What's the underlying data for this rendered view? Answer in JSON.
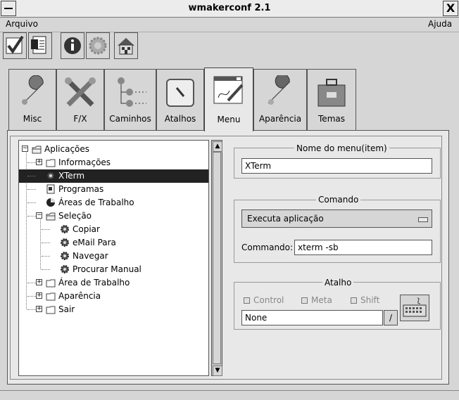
{
  "window": {
    "title": "wmakerconf 2.1",
    "close_glyph": "X"
  },
  "menubar": {
    "left": "Arquivo",
    "right": "Ajuda"
  },
  "toolbar": [
    {
      "icon": "checkmark-icon"
    },
    {
      "icon": "document-icon"
    },
    {
      "icon": "info-icon"
    },
    {
      "icon": "gear-icon"
    },
    {
      "icon": "house-icon"
    }
  ],
  "tabs": [
    {
      "label": "Misc"
    },
    {
      "label": "F/X"
    },
    {
      "label": "Caminhos"
    },
    {
      "label": "Atalhos"
    },
    {
      "label": "Menu",
      "active": true
    },
    {
      "label": "Aparência"
    },
    {
      "label": "Temas"
    }
  ],
  "tree": [
    {
      "label": "Aplicações",
      "level": 0,
      "icon": "folder-open",
      "expander": "−"
    },
    {
      "label": "Informações",
      "level": 1,
      "icon": "folder",
      "expander": "+"
    },
    {
      "label": "XTerm",
      "level": 1,
      "icon": "gear",
      "selected": true
    },
    {
      "label": "Programas",
      "level": 1,
      "icon": "doc"
    },
    {
      "label": "Áreas de Trabalho",
      "level": 1,
      "icon": "pie"
    },
    {
      "label": "Seleção",
      "level": 1,
      "icon": "folder-open",
      "expander": "−"
    },
    {
      "label": "Copiar",
      "level": 2,
      "icon": "gear"
    },
    {
      "label": "eMail Para",
      "level": 2,
      "icon": "gear"
    },
    {
      "label": "Navegar",
      "level": 2,
      "icon": "gear"
    },
    {
      "label": "Procurar Manual",
      "level": 2,
      "icon": "gear"
    },
    {
      "label": "Área de Trabalho",
      "level": 1,
      "icon": "folder",
      "expander": "+"
    },
    {
      "label": "Aparência",
      "level": 1,
      "icon": "folder",
      "expander": "+"
    },
    {
      "label": "Sair",
      "level": 1,
      "icon": "folder",
      "expander": "+"
    }
  ],
  "menu_item": {
    "title": "Nome do menu(item)",
    "value": "XTerm"
  },
  "command": {
    "title": "Comando",
    "action": "Executa aplicação",
    "label": "Commando:",
    "value": "xterm -sb"
  },
  "shortcut": {
    "title": "Atalho",
    "control": "Control",
    "meta": "Meta",
    "shift": "Shift",
    "value": "None",
    "slash": "/"
  }
}
